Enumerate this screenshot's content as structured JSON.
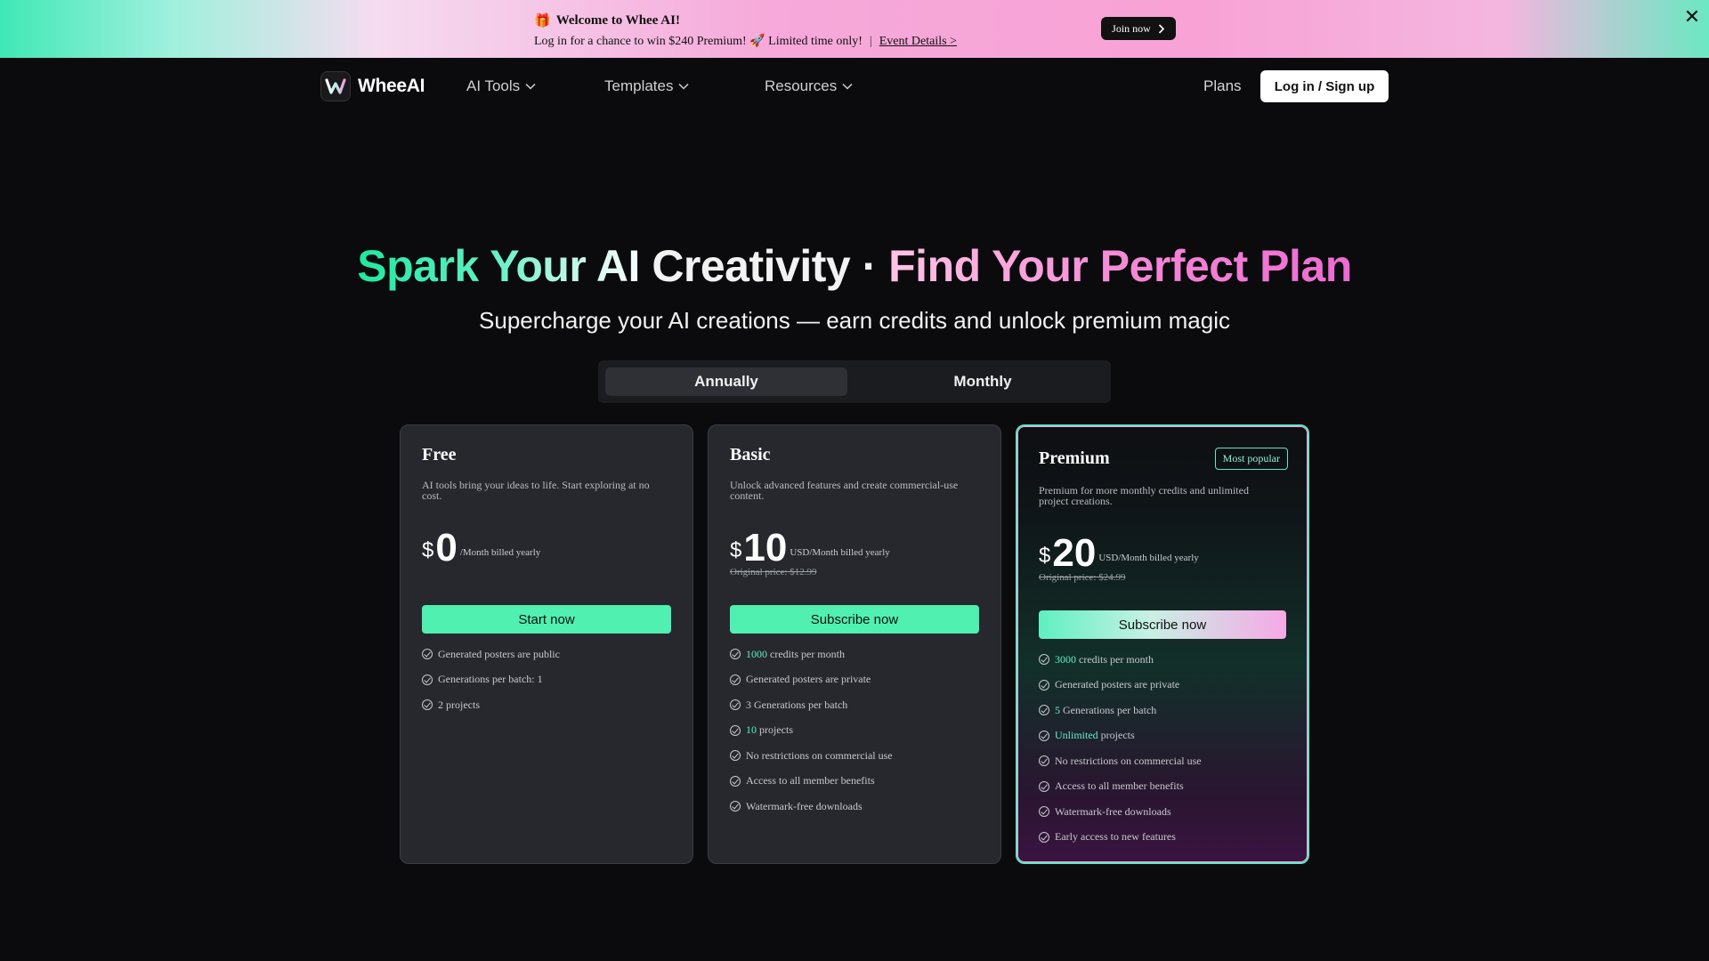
{
  "promo": {
    "gift": "🎁",
    "title": "Welcome to Whee AI!",
    "message": "Log in for a chance to win $240 Premium! 🚀 Limited time only!",
    "separator": "|",
    "link": "Event Details >",
    "join_label": "Join now",
    "close": "✕"
  },
  "nav": {
    "brand": "WheeAI",
    "items": [
      {
        "label": "AI Tools"
      },
      {
        "label": "Templates"
      },
      {
        "label": "Resources"
      }
    ],
    "plans": "Plans",
    "login": "Log in / Sign up"
  },
  "hero": {
    "title_part1": "Spark Your AI ",
    "title_part2": "Creativity · ",
    "title_part3": "Find Your Perfect Plan",
    "subtitle": "Supercharge your AI creations — earn credits and unlock premium magic"
  },
  "billing_toggle": {
    "annually": "Annually",
    "monthly": "Monthly",
    "selected": "Annually"
  },
  "plans": [
    {
      "name": "Free",
      "desc": "AI tools bring your ideas to life. Start exploring at no cost.",
      "currency": "$",
      "price": "0",
      "per": "/Month billed yearly",
      "cta": "Start now",
      "features": [
        {
          "hl": "",
          "text": "Generated posters are public"
        },
        {
          "hl": "",
          "text": "Generations per batch: 1"
        },
        {
          "hl": "",
          "text": "2 projects"
        }
      ]
    },
    {
      "name": "Basic",
      "desc": "Unlock advanced features and create commercial-use content.",
      "currency": "$",
      "price": "10",
      "per": "USD/Month billed yearly",
      "original": "Original price: $12.99",
      "cta": "Subscribe now",
      "features": [
        {
          "hl": "1000",
          "text": " credits per month"
        },
        {
          "hl": "",
          "text": "Generated posters are private"
        },
        {
          "hl": "",
          "text": "3 Generations per batch"
        },
        {
          "hl": "10",
          "text": " projects"
        },
        {
          "hl": "",
          "text": "No restrictions on commercial use"
        },
        {
          "hl": "",
          "text": "Access to all member benefits"
        },
        {
          "hl": "",
          "text": "Watermark-free downloads"
        }
      ]
    },
    {
      "name": "Premium",
      "badge": "Most popular",
      "desc": "Premium for more monthly credits and unlimited project creations.",
      "currency": "$",
      "price": "20",
      "per": "USD/Month billed yearly",
      "original": "Original price: $24.99",
      "cta": "Subscribe now",
      "features": [
        {
          "hl": "3000",
          "text": " credits per month"
        },
        {
          "hl": "",
          "text": "Generated posters are private"
        },
        {
          "hl": "5",
          "text": " Generations per batch"
        },
        {
          "hl": "Unlimited",
          "text": " projects"
        },
        {
          "hl": "",
          "text": "No restrictions on commercial use"
        },
        {
          "hl": "",
          "text": "Access to all member benefits"
        },
        {
          "hl": "",
          "text": "Watermark-free downloads"
        },
        {
          "hl": "",
          "text": "Early access to new features"
        }
      ]
    }
  ],
  "colors": {
    "accent_green": "#4ff0b0",
    "accent_pink": "#f48ad6",
    "background": "#0b0b0d",
    "card": "#26282d"
  }
}
